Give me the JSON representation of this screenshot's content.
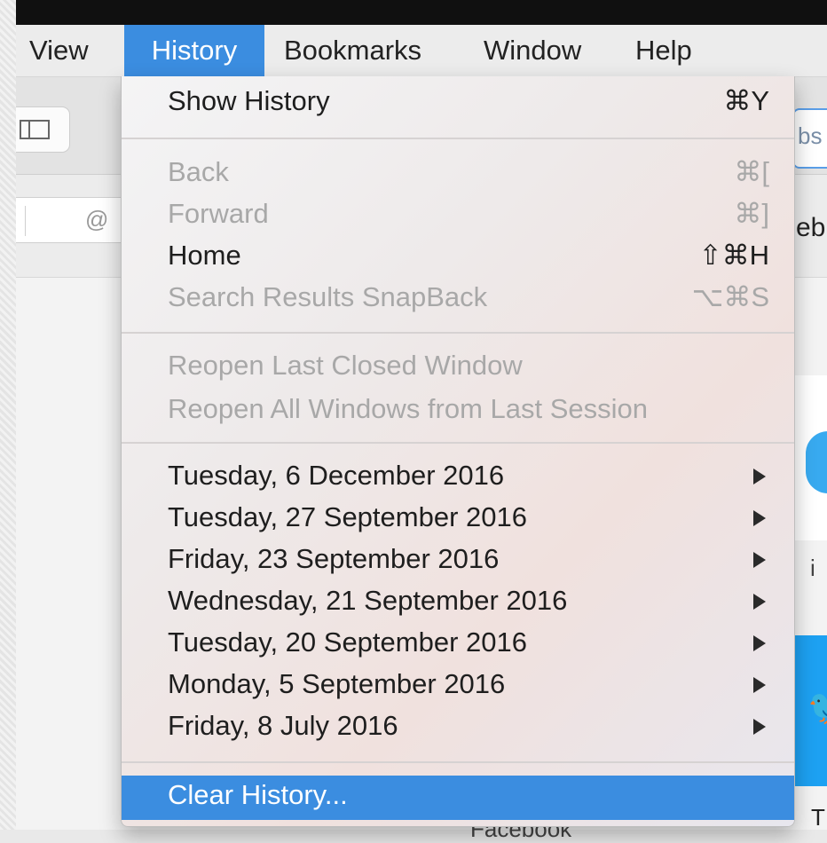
{
  "menubar": {
    "items": [
      {
        "label": "View"
      },
      {
        "label": "History"
      },
      {
        "label": "Bookmarks"
      },
      {
        "label": "Window"
      },
      {
        "label": "Help"
      }
    ],
    "active_item": "History"
  },
  "background": {
    "address_field": {
      "symbol": "@"
    },
    "tab_fragment": "bs",
    "side_text_fragment": "eb",
    "side_letter_i": "i",
    "side_letter_t": "T",
    "caption": "Facebook",
    "brand_icon": "twitter-bird-icon",
    "accent_colors": {
      "cloud": "#38aaf0",
      "twitter": "#1da1f2",
      "selection": "#3b8de0"
    }
  },
  "history_menu": {
    "show_history": {
      "label": "Show History",
      "shortcut": "⌘Y"
    },
    "back": {
      "label": "Back",
      "shortcut": "⌘["
    },
    "forward": {
      "label": "Forward",
      "shortcut": "⌘]"
    },
    "home": {
      "label": "Home",
      "shortcut": "⇧⌘H"
    },
    "snapback": {
      "label": "Search Results SnapBack",
      "shortcut": "⌥⌘S"
    },
    "reopen_window": {
      "label": "Reopen Last Closed Window"
    },
    "reopen_all": {
      "label": "Reopen All Windows from Last Session"
    },
    "dates": [
      {
        "label": "Tuesday, 6 December 2016"
      },
      {
        "label": "Tuesday, 27 September 2016"
      },
      {
        "label": "Friday, 23 September 2016"
      },
      {
        "label": "Wednesday, 21 September 2016"
      },
      {
        "label": "Tuesday, 20 September 2016"
      },
      {
        "label": "Monday, 5 September 2016"
      },
      {
        "label": "Friday, 8 July 2016"
      }
    ],
    "clear_history": {
      "label": "Clear History..."
    }
  }
}
